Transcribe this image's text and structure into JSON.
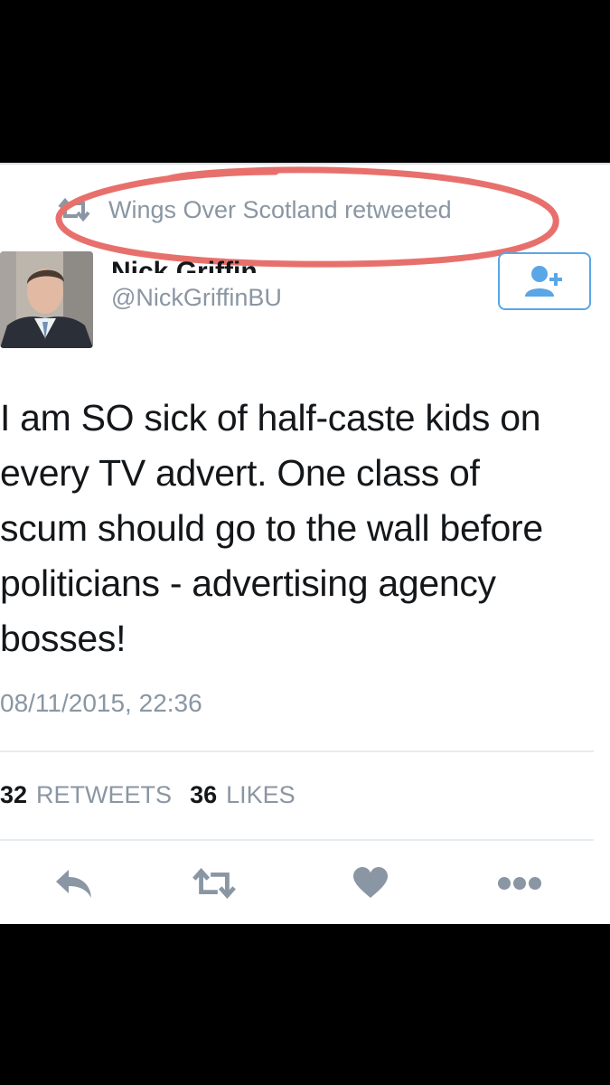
{
  "retweet_context": {
    "text": "Wings Over Scotland retweeted"
  },
  "user": {
    "name": "Nick Griffin",
    "handle": "@NickGriffinBU"
  },
  "follow_button": {
    "icon": "add-user-icon"
  },
  "tweet": {
    "text": "I am SO sick of half-caste kids on\nevery TV advert. One class of\nscum should go to the wall before\npoliticians - advertising agency\nbosses!",
    "timestamp": "08/11/2015, 22:36"
  },
  "stats": {
    "retweets_count": "32",
    "retweets_label": "RETWEETS",
    "likes_count": "36",
    "likes_label": "LIKES"
  },
  "actions": [
    "reply-icon",
    "retweet-icon",
    "like-icon",
    "more-icon"
  ],
  "colors": {
    "annotation_circle": "#e8706c",
    "twitter_blue": "#5aa6e6",
    "muted_text": "#8a96a3"
  }
}
